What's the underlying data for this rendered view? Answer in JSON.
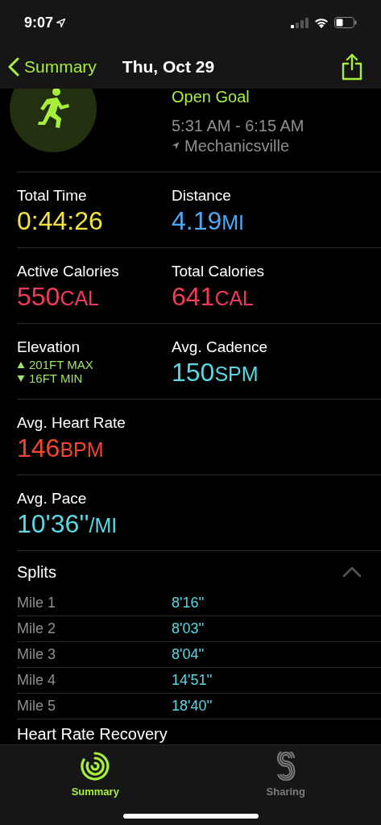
{
  "status_bar": {
    "time": "9:07"
  },
  "nav": {
    "back": "Summary",
    "title": "Thu, Oct 29"
  },
  "workout": {
    "goal": "Open Goal",
    "time_range": "5:31 AM - 6:15 AM",
    "location": "Mechanicsville"
  },
  "metric_rows": [
    {
      "metrics": [
        {
          "kind": "value",
          "label": "Total Time",
          "value": "0:44:26",
          "color": "#f2e33c"
        },
        {
          "kind": "value",
          "label": "Distance",
          "value": "4.19",
          "unit": "MI",
          "color": "#4fa9f2"
        }
      ]
    },
    {
      "metrics": [
        {
          "kind": "value",
          "label": "Active Calories",
          "value": "550",
          "unit": "CAL",
          "color": "#f23a5c"
        },
        {
          "kind": "value",
          "label": "Total Calories",
          "value": "641",
          "unit": "CAL",
          "color": "#f23a5c"
        }
      ]
    },
    {
      "metrics": [
        {
          "kind": "elevation",
          "label": "Elevation",
          "max": "201FT MAX",
          "min": "16FT MIN",
          "color": "#9ee36a"
        },
        {
          "kind": "value",
          "label": "Avg. Cadence",
          "value": "150",
          "unit": "SPM",
          "color": "#5ad8e2"
        }
      ]
    },
    {
      "metrics": [
        {
          "kind": "value",
          "label": "Avg. Heart Rate",
          "value": "146",
          "unit": "BPM",
          "color": "#f2472e"
        }
      ]
    },
    {
      "metrics": [
        {
          "kind": "value",
          "label": "Avg. Pace",
          "value": "10'36''",
          "unit": "/MI",
          "color": "#5ad8e2"
        }
      ]
    }
  ],
  "splits": {
    "title": "Splits",
    "expanded": true,
    "rows": [
      {
        "label": "Mile 1",
        "time": "8'16''"
      },
      {
        "label": "Mile 2",
        "time": "8'03''"
      },
      {
        "label": "Mile 3",
        "time": "8'04''"
      },
      {
        "label": "Mile 4",
        "time": "14'51''"
      },
      {
        "label": "Mile 5",
        "time": "18'40''"
      }
    ]
  },
  "next_section": {
    "title": "Heart Rate Recovery"
  },
  "tabs": [
    {
      "kind": "activity",
      "label": "Summary",
      "selected": true
    },
    {
      "kind": "sharing",
      "label": "Sharing",
      "selected": false
    }
  ]
}
